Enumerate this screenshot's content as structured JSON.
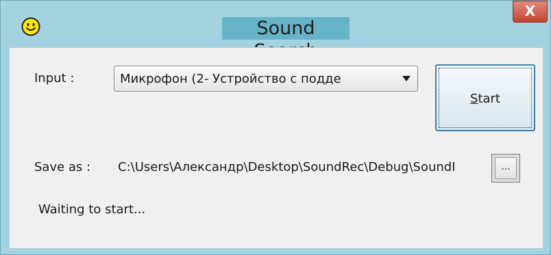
{
  "window": {
    "title": "Sound Search",
    "close_label": "X",
    "icon": "smiley-icon"
  },
  "input": {
    "label": "Input :",
    "selected_device": "Микрофон (2- Устройство с подде"
  },
  "start_button": {
    "mnemonic": "S",
    "rest": "tart"
  },
  "save": {
    "label": "Save as :",
    "path": "C:\\Users\\Александр\\Desktop\\SoundRec\\Debug\\SoundI",
    "browse_label": "..."
  },
  "status": {
    "text": "Waiting to start..."
  },
  "colors": {
    "frame": "#a3d3e1",
    "title_highlight": "#66b4c8",
    "close": "#c4432f",
    "client": "#f0f0f0",
    "button_border": "#3c7fb1"
  }
}
